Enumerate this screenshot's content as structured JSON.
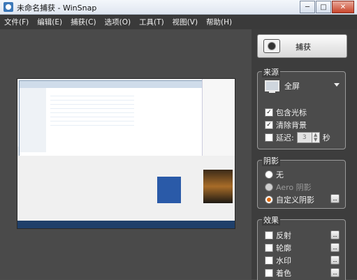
{
  "window": {
    "title": "未命名捕获 - WinSnap",
    "minimize": "─",
    "maximize": "□",
    "close": "✕"
  },
  "menu": [
    "文件(F)",
    "编辑(E)",
    "捕获(C)",
    "选项(O)",
    "工具(T)",
    "视图(V)",
    "帮助(H)"
  ],
  "capture": {
    "label": "捕获",
    "icon": "camera-icon"
  },
  "source": {
    "title": "来源",
    "selected": "全屏",
    "icon": "monitor-icon",
    "options": [
      {
        "label": "包含光标",
        "checked": true
      },
      {
        "label": "清除背景",
        "checked": true
      },
      {
        "label": "延迟:",
        "checked": false,
        "value": "3",
        "unit": "秒"
      }
    ]
  },
  "shadow": {
    "title": "阴影",
    "options": [
      {
        "label": "无",
        "selected": false,
        "enabled": true
      },
      {
        "label": "Aero 阴影",
        "selected": false,
        "enabled": false
      },
      {
        "label": "自定义阴影",
        "selected": true,
        "enabled": true
      }
    ]
  },
  "effects": {
    "title": "效果",
    "options": [
      {
        "label": "反射",
        "checked": false
      },
      {
        "label": "轮廓",
        "checked": false
      },
      {
        "label": "水印",
        "checked": false
      },
      {
        "label": "着色",
        "checked": false
      }
    ]
  },
  "colors": {
    "menubar": "#3a3a3a",
    "panel": "#3d3d3d",
    "radio_selected": "#e06a10"
  }
}
